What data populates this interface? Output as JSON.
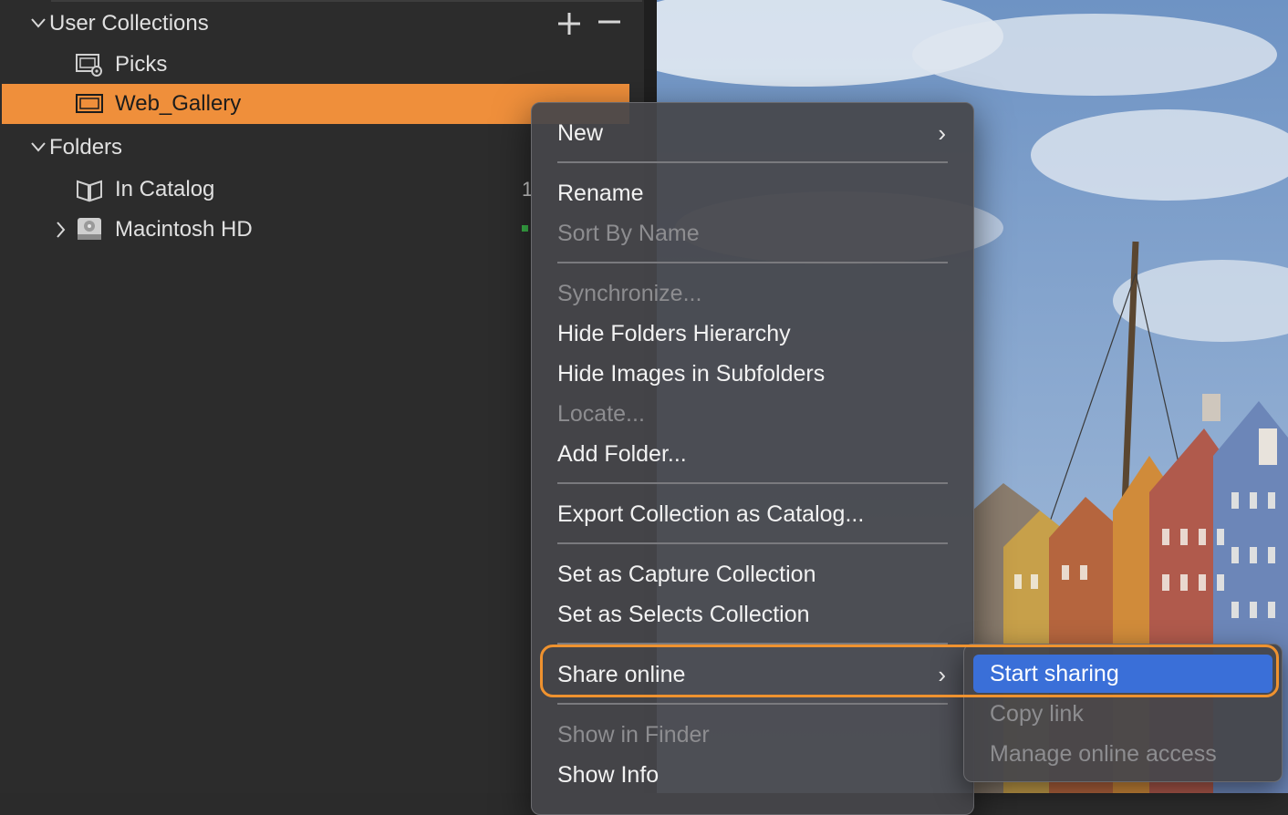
{
  "browser": {
    "user_collections": {
      "label": "User Collections",
      "add_glyph": "+",
      "remove_glyph": "−",
      "items": [
        {
          "label": "Picks",
          "icon": "smart-album-icon"
        },
        {
          "label": "Web_Gallery",
          "icon": "album-icon",
          "selected": true
        }
      ]
    },
    "folders": {
      "label": "Folders",
      "items": [
        {
          "label": "In Catalog",
          "icon": "catalog-book-icon",
          "count": "1"
        },
        {
          "label": "Macintosh HD",
          "icon": "hard-drive-icon"
        }
      ]
    }
  },
  "context_menu": {
    "items": {
      "new": "New",
      "rename": "Rename",
      "sort_by_name": "Sort By Name",
      "synchronize": "Synchronize...",
      "hide_folders_hierarchy": "Hide Folders Hierarchy",
      "hide_images_in_subfolders": "Hide Images in Subfolders",
      "locate": "Locate...",
      "add_folder": "Add Folder...",
      "export_collection": "Export Collection as Catalog...",
      "set_capture": "Set as Capture Collection",
      "set_selects": "Set as Selects Collection",
      "share_online": "Share online",
      "show_in_finder": "Show in Finder",
      "show_info": "Show Info"
    },
    "submenu_glyph": "›"
  },
  "share_submenu": {
    "start_sharing": "Start sharing",
    "copy_link": "Copy link",
    "manage_access": "Manage online access"
  },
  "colors": {
    "selection": "#ef8f3b",
    "highlight_ring": "#ef922f",
    "menu_active": "#3a6fd8"
  }
}
